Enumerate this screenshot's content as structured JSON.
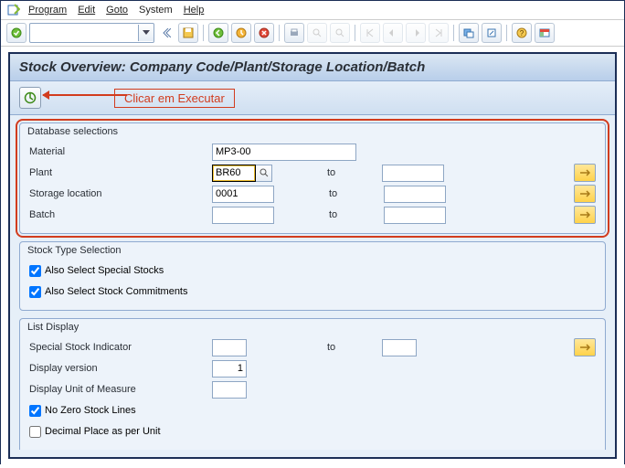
{
  "menu": {
    "program": "Program",
    "edit": "Edit",
    "goto": "Goto",
    "system": "System",
    "help": "Help"
  },
  "title": "Stock Overview: Company Code/Plant/Storage Location/Batch",
  "annotation": "Clicar em Executar",
  "db_sel": {
    "title": "Database selections",
    "material_lbl": "Material",
    "material_val": "MP3-00",
    "plant_lbl": "Plant",
    "plant_val": "BR60",
    "plant_to": "to",
    "plant_to_val": "",
    "sloc_lbl": "Storage location",
    "sloc_val": "0001",
    "sloc_to": "to",
    "sloc_to_val": "",
    "batch_lbl": "Batch",
    "batch_val": "",
    "batch_to": "to",
    "batch_to_val": ""
  },
  "stock_type": {
    "title": "Stock Type Selection",
    "special": "Also Select Special Stocks",
    "commit": "Also Select Stock Commitments"
  },
  "list": {
    "title": "List Display",
    "ssi": "Special Stock Indicator",
    "ssi_val": "",
    "to": "to",
    "ssi_to_val": "",
    "dv": "Display version",
    "dv_val": "1",
    "duom": "Display Unit of Measure",
    "duom_val": "",
    "nz": "No Zero Stock Lines",
    "dec": "Decimal Place as per Unit"
  }
}
